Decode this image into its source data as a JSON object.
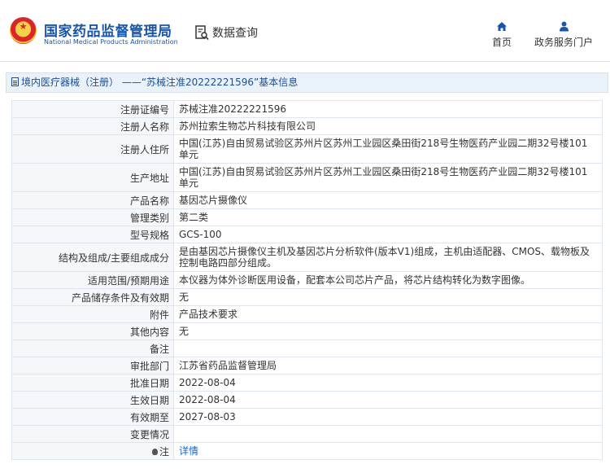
{
  "header": {
    "agency_cn": "国家药品监督管理局",
    "agency_en": "National Medical Products Administration",
    "data_query": "数据查询",
    "nav_home": "首页",
    "nav_service": "政务服务门户"
  },
  "breadcrumb": "境内医疗器械（注册） ——“苏械注准20222221596”基本信息",
  "rows": [
    {
      "label": "注册证编号",
      "value": "苏械注准20222221596"
    },
    {
      "label": "注册人名称",
      "value": "苏州拉索生物芯片科技有限公司"
    },
    {
      "label": "注册人住所",
      "value": "中国(江苏)自由贸易试验区苏州片区苏州工业园区桑田街218号生物医药产业园二期32号楼101单元"
    },
    {
      "label": "生产地址",
      "value": "中国(江苏)自由贸易试验区苏州片区苏州工业园区桑田街218号生物医药产业园二期32号楼101单元"
    },
    {
      "label": "产品名称",
      "value": "基因芯片摄像仪"
    },
    {
      "label": "管理类别",
      "value": "第二类"
    },
    {
      "label": "型号规格",
      "value": "GCS-100"
    },
    {
      "label": "结构及组成/主要组成成分",
      "value": "是由基因芯片摄像仪主机及基因芯片分析软件(版本V1)组成，主机由适配器、CMOS、载物板及控制电路四部分组成。"
    },
    {
      "label": "适用范围/预期用途",
      "value": "本仪器为体外诊断医用设备，配套本公司芯片产品，将芯片结构转化为数字图像。"
    },
    {
      "label": "产品储存条件及有效期",
      "value": "无"
    },
    {
      "label": "附件",
      "value": "产品技术要求"
    },
    {
      "label": "其他内容",
      "value": "无"
    },
    {
      "label": "备注",
      "value": ""
    },
    {
      "label": "审批部门",
      "value": "江苏省药品监督管理局"
    },
    {
      "label": "批准日期",
      "value": "2022-08-04"
    },
    {
      "label": "生效日期",
      "value": "2022-08-04"
    },
    {
      "label": "有效期至",
      "value": "2027-08-03"
    },
    {
      "label": "变更情况",
      "value": ""
    }
  ],
  "note": {
    "label": "注",
    "link": "详情"
  },
  "colors": {
    "brand_blue": "#1a56a8",
    "link_blue": "#1a64c8",
    "label_bg": "#f5f7fa",
    "crumb_bg": "#e9f1fb"
  },
  "icons": {
    "emblem": "national-emblem-icon",
    "query": "document-search-icon",
    "home": "home-icon",
    "service": "user-icon",
    "note": "lightbulb-icon"
  }
}
